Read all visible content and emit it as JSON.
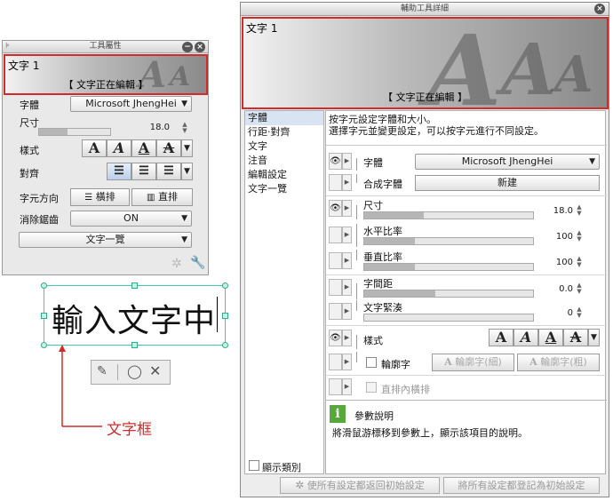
{
  "tool_property": {
    "title": "工具屬性",
    "preview": {
      "name": "文字 1",
      "status": "【 文字正在編輯 】"
    },
    "font_label": "字體",
    "font_value": "Microsoft JhengHei",
    "size_label": "尺寸",
    "size_value": "18.0",
    "style_label": "樣式",
    "align_label": "對齊",
    "direction_label": "字元方向",
    "direction_horizontal": "橫排",
    "direction_vertical": "直排",
    "antialias_label": "消除鋸齒",
    "antialias_value": "ON",
    "text_list_button": "文字一覽"
  },
  "text_frame": {
    "content": "輸入文字中",
    "annotation": "文字框",
    "annotation_color": "#d42a2a"
  },
  "subtool_detail": {
    "title": "輔助工具詳細",
    "preview": {
      "name": "文字 1",
      "status": "【 文字正在編輯 】"
    },
    "categories": [
      {
        "label": "字體",
        "selected": true
      },
      {
        "label": "行距·對齊",
        "selected": false
      },
      {
        "label": "文字",
        "selected": false
      },
      {
        "label": "注音",
        "selected": false
      },
      {
        "label": "編輯設定",
        "selected": false
      },
      {
        "label": "文字一覽",
        "selected": false
      }
    ],
    "show_category_label": "顯示類別",
    "description": "按字元設定字體和大小。\n選擇字元並變更設定，可以按字元進行不同設定。",
    "font": {
      "label": "字體",
      "value": "Microsoft JhengHei"
    },
    "composite_font": {
      "label": "合成字體",
      "button": "新建"
    },
    "size": {
      "label": "尺寸",
      "value": "18.0",
      "fill": 0.35
    },
    "h_ratio": {
      "label": "水平比率",
      "value": "100",
      "fill": 0.3
    },
    "v_ratio": {
      "label": "垂直比率",
      "value": "100",
      "fill": 0.3
    },
    "spacing": {
      "label": "字間距",
      "value": "0.0",
      "fill": 0.42
    },
    "tightness": {
      "label": "文字緊湊",
      "value": "0"
    },
    "style_label": "樣式",
    "outline": {
      "label": "輪廓字",
      "thin": "輪廓字(細)",
      "thick": "輪廓字(粗)"
    },
    "tcy": {
      "label": "直排內橫排"
    },
    "param_help_title": "參數說明",
    "param_help_text": "將滑鼠游標移到參數上，顯示該項目的說明。",
    "reset_button": "使所有設定都返回初始設定",
    "register_button": "將所有設定都登記為初始設定"
  }
}
